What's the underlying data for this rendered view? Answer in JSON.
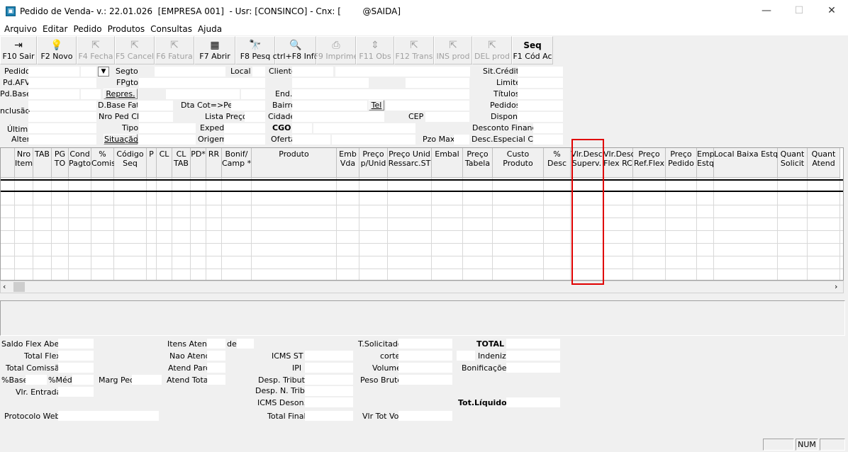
{
  "window": {
    "title": "Pedido de Venda- v.: 22.01.026  [EMPRESA 001]  - Usr: [CONSINCO] - Cnx: [        @SAIDA]",
    "minimize": "—",
    "maximize": "☐",
    "close": "✕"
  },
  "menu": [
    "Arquivo",
    "Editar",
    "Pedido",
    "Produtos",
    "Consultas",
    "Ajuda"
  ],
  "toolbar": [
    {
      "label": "F10 Sair",
      "icon": "⇥",
      "w": 52,
      "enabled": true
    },
    {
      "label": "F2 Novo",
      "icon": "💡",
      "w": 56,
      "enabled": true
    },
    {
      "label": "F4 Fecha",
      "icon": "⇱",
      "w": 54,
      "enabled": false
    },
    {
      "label": "F5 Cancel",
      "icon": "⇱",
      "w": 56,
      "enabled": false
    },
    {
      "label": "F6 Fatura",
      "icon": "⇱",
      "w": 56,
      "enabled": false
    },
    {
      "label": "F7 Abrir",
      "icon": "▦",
      "w": 58,
      "enabled": true
    },
    {
      "label": "F8 Pesq",
      "icon": "🔭",
      "w": 56,
      "enabled": true
    },
    {
      "label": "ctrl+F8 Info",
      "icon": "🔍",
      "w": 58,
      "enabled": true
    },
    {
      "label": "F9 Imprime",
      "icon": "⎙",
      "w": 56,
      "enabled": false
    },
    {
      "label": "F11 Obs",
      "icon": "⇕",
      "w": 54,
      "enabled": false
    },
    {
      "label": "F12 Trans",
      "icon": "⇱",
      "w": 56,
      "enabled": false
    },
    {
      "label": "INS prod",
      "icon": "⇱",
      "w": 54,
      "enabled": false
    },
    {
      "label": "DEL prod",
      "icon": "⇱",
      "w": 56,
      "enabled": false
    },
    {
      "label": "F1 Cód Ac",
      "icon": "Seq",
      "w": 58,
      "enabled": true
    }
  ],
  "header": {
    "pedido": "Pedido",
    "segto": "Segto",
    "local": "Local",
    "cliente": "Cliente",
    "sit_credito": "Sit.Crédito",
    "pd_afv": "Pd.AFV",
    "fpgto": "FPgto",
    "limite": "Limite",
    "pd_base": "Pd.Base",
    "repres": "Repres.",
    "end": "End.",
    "titulos": "Títulos",
    "inclusao": "nclusão",
    "d_base_fat": "D.Base Fat",
    "dta_cot_ped": "Dta Cot=>Ped",
    "bairro": "Bairro",
    "tel": "Tel",
    "pedidos": "Pedidos",
    "nro_ped_cli": "Nro Ped Cli",
    "lista_preco": "Lista Preço",
    "cidade": "Cidade",
    "cep": "CEP",
    "dispon": "Dispon.",
    "ultima": "Última",
    "tipo": "Tipo",
    "exped": "Exped",
    "cgo": "CGO",
    "desconto_financ": "Desconto Financ.",
    "alter": "Alter",
    "situacao": "Situação",
    "origem": "Origem",
    "oferta": "Oferta",
    "pzo_max": "Pzo Max",
    "desc_especial": "Desc.Especial Cli."
  },
  "grid": {
    "columns": [
      {
        "label": "Nro\nItem",
        "w": 26
      },
      {
        "label": "TAB",
        "w": 26
      },
      {
        "label": "PG\nTO",
        "w": 24
      },
      {
        "label": "Cond\nPagto",
        "w": 32
      },
      {
        "label": "%\nComis",
        "w": 32
      },
      {
        "label": "Código\nSeq",
        "w": 46
      },
      {
        "label": "P",
        "w": 14
      },
      {
        "label": "CL",
        "w": 22
      },
      {
        "label": "CL\nTAB",
        "w": 26
      },
      {
        "label": "PD*",
        "w": 22
      },
      {
        "label": "RR",
        "w": 22
      },
      {
        "label": "Bonif/\nCamp *",
        "w": 42
      },
      {
        "label": "Produto",
        "w": 120
      },
      {
        "label": "Emb\nVda",
        "w": 32
      },
      {
        "label": "Preço\np/Unid",
        "w": 40
      },
      {
        "label": "Preço Unid\nRessarc.ST",
        "w": 62
      },
      {
        "label": "Embal",
        "w": 44
      },
      {
        "label": "Preço\nTabela",
        "w": 42
      },
      {
        "label": "Custo\nProduto",
        "w": 72
      },
      {
        "label": "%\nDesc",
        "w": 38
      },
      {
        "label": "Vlr.Desc\nSuperv.",
        "w": 46
      },
      {
        "label": "Vlr.Desc\nFlex RC",
        "w": 42
      },
      {
        "label": "Preço\nRef.Flex",
        "w": 46
      },
      {
        "label": "Preço\nPedido",
        "w": 44
      },
      {
        "label": "Emp\nEstq",
        "w": 24
      },
      {
        "label": "Local Baixa Estq.",
        "w": 90
      },
      {
        "label": "Quant\nSolicit",
        "w": 42
      },
      {
        "label": "Quant\nAtend",
        "w": 46
      }
    ]
  },
  "footer": {
    "saldo_flex": "Saldo Flex Abert",
    "total_flex": "Total Flex",
    "total_comissao": "Total Comissão",
    "pct_base": "%Base",
    "pct_med": "%Méd.",
    "marg_ped": "Marg Ped",
    "vlr_entrada": "Vlr. Entrada",
    "protocolo_web": "Protocolo Web",
    "itens_atend": "Itens Atend",
    "de": "de",
    "nao_atend": "Nao Atend",
    "atend_parc": "Atend Parc",
    "atend_total": "Atend Total",
    "icms_st": "ICMS ST",
    "ipi": "IPI",
    "desp_tribut": "Desp. Tribut.",
    "desp_n_trib": "Desp. N. Trib.",
    "icms_deson": "ICMS Deson.",
    "total_final": "Total Final",
    "t_solicitado": "T.Solicitado",
    "corte": "corte",
    "volume": "Volume",
    "peso_bruto": "Peso Bruto",
    "vlr_tot_vol": "Vlr Tot Vol",
    "total": "TOTAL",
    "indeniz": "Indeniz.",
    "bonificacoes": "Bonificações",
    "tot_liquido": "Tot.Líquido"
  },
  "status": {
    "num": "NUM"
  }
}
